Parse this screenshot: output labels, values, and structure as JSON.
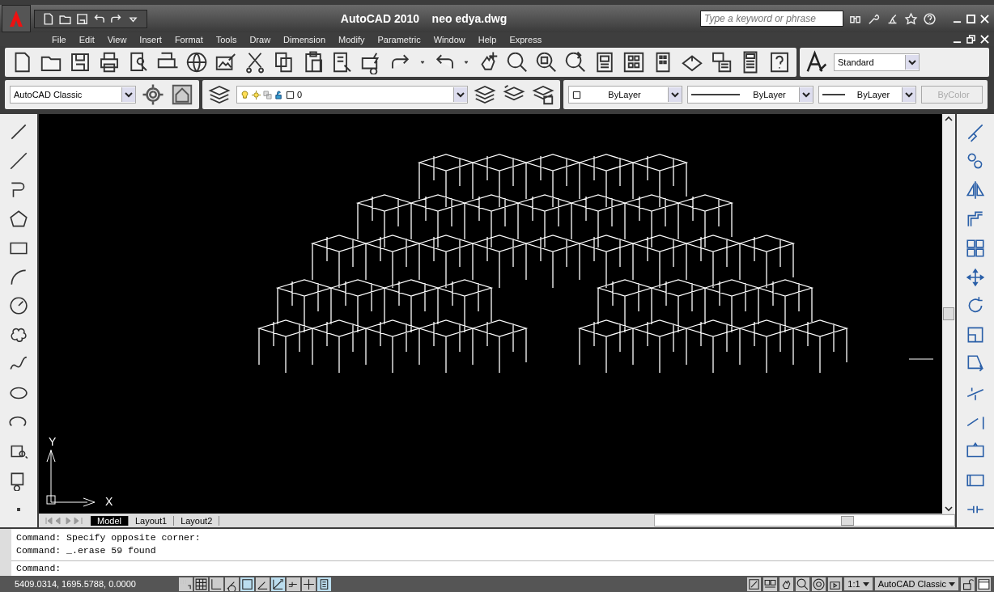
{
  "title_bar": {
    "app": "AutoCAD 2010",
    "file": "neo edya.dwg",
    "search": {
      "placeholder": "Type a keyword or phrase"
    }
  },
  "menu": [
    "File",
    "Edit",
    "View",
    "Insert",
    "Format",
    "Tools",
    "Draw",
    "Dimension",
    "Modify",
    "Parametric",
    "Window",
    "Help",
    "Express"
  ],
  "text_style": "Standard",
  "workspace": "AutoCAD Classic",
  "layer": "0",
  "properties": [
    {
      "kind": "color",
      "value": "ByLayer",
      "disabled": false
    },
    {
      "kind": "linetype",
      "value": "ByLayer",
      "disabled": false
    },
    {
      "kind": "lineweight",
      "value": "ByLayer",
      "disabled": false
    },
    {
      "kind": "plotstyle",
      "value": "ByColor",
      "disabled": true
    }
  ],
  "ucs": {
    "x": "X",
    "y": "Y"
  },
  "layout_tabs": [
    {
      "label": "Model",
      "selected": true
    },
    {
      "label": "Layout1",
      "selected": false
    },
    {
      "label": "Layout2",
      "selected": false
    }
  ],
  "command_history": [
    "Command: Specify opposite corner:",
    "Command: _.erase 59 found"
  ],
  "command_prompt": "Command:",
  "status_bar": {
    "coordinates": "5409.0314, 1695.5788, 0.0000",
    "toggles": [
      {
        "on": false
      },
      {
        "on": false
      },
      {
        "on": false
      },
      {
        "on": false
      },
      {
        "on": true
      },
      {
        "on": false
      },
      {
        "on": true
      },
      {
        "on": false
      },
      {
        "on": false
      },
      {
        "on": true
      }
    ],
    "annotation_scale": "1:1",
    "workspace": "AutoCAD Classic"
  }
}
